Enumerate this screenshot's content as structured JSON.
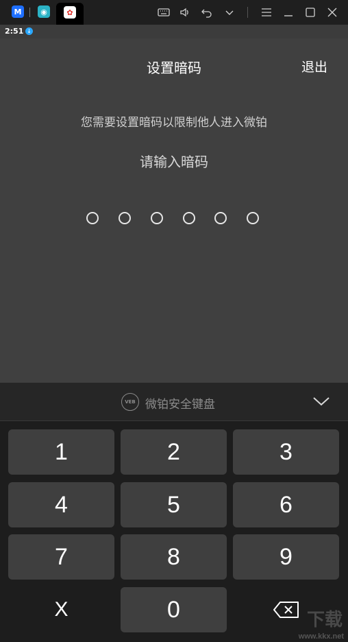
{
  "emulator": {
    "tabs": [
      {
        "name": "m-app",
        "glyph": "M",
        "color": "#1e6fff"
      },
      {
        "name": "game-app",
        "glyph": "◉",
        "color": "#2bb3c6"
      },
      {
        "name": "weibo-app",
        "glyph": "✿",
        "color": "#ffffff"
      }
    ]
  },
  "status": {
    "time": "2:51"
  },
  "app": {
    "title": "设置暗码",
    "exit_label": "退出",
    "description": "您需要设置暗码以限制他人进入微铂",
    "prompt": "请输入暗码",
    "pin_length": 6
  },
  "keyboard": {
    "title": "微铂安全键盘",
    "logo_text": "VEB",
    "keys": {
      "k1": "1",
      "k2": "2",
      "k3": "3",
      "k4": "4",
      "k5": "5",
      "k6": "6",
      "k7": "7",
      "k8": "8",
      "k9": "9",
      "clear": "X",
      "k0": "0"
    }
  },
  "watermark": {
    "text": "www.kkx.net",
    "big": "下载"
  },
  "colors": {
    "app_bg": "#404040",
    "keyboard_bg": "#1d1d1d",
    "key_bg": "#3f3f3f",
    "accent_blue": "#2aa8ff"
  }
}
